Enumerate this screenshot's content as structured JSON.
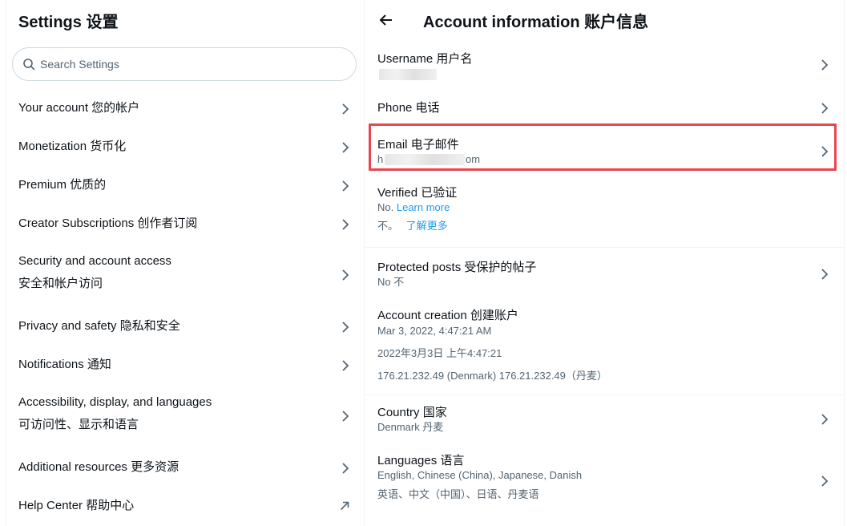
{
  "settings": {
    "title": "Settings 设置",
    "search_placeholder": "Search Settings",
    "items": [
      {
        "label": "Your account  您的帐户"
      },
      {
        "label": "Monetization  货币化"
      },
      {
        "label": "Premium  优质的"
      },
      {
        "label": "Creator Subscriptions  创作者订阅"
      },
      {
        "label": "Security and account access",
        "label2": "安全和帐户访问"
      },
      {
        "label": "Privacy and safety  隐私和安全"
      },
      {
        "label": "Notifications  通知"
      },
      {
        "label": "Accessibility, display, and languages",
        "label2": "可访问性、显示和语言"
      },
      {
        "label": "Additional resources  更多资源"
      },
      {
        "label": "Help Center  帮助中心"
      }
    ]
  },
  "account": {
    "title": "Account information  账户信息",
    "username_label": "Username  用户名",
    "phone_label": "Phone  电话",
    "email_label": "Email  电子邮件",
    "email_value_prefix": "h",
    "email_value_suffix": "om",
    "verified_label": "Verified  已验证",
    "verified_no": "No.",
    "learn_more": "Learn more",
    "verified_no_cn": "不。",
    "learn_more_cn": "了解更多",
    "protected_label": "Protected posts  受保护的帖子",
    "protected_value": "No  不",
    "creation_label": "Account creation  创建账户",
    "creation_date": "Mar 3, 2022, 4:47:21 AM",
    "creation_date_cn": "2022年3月3日 上午4:47:21",
    "creation_ip": "176.21.232.49 (Denmark)  176.21.232.49（丹麦）",
    "country_label": "Country  国家",
    "country_value": "Denmark  丹麦",
    "languages_label": "Languages  语言",
    "languages_value": "English, Chinese (China), Japanese, Danish",
    "languages_value_cn": "英语、中文（中国）、日语、丹麦语"
  },
  "colors": {
    "accent": "#1d9bf0",
    "highlight_border": "#e8464f",
    "secondary_text": "#536471"
  }
}
